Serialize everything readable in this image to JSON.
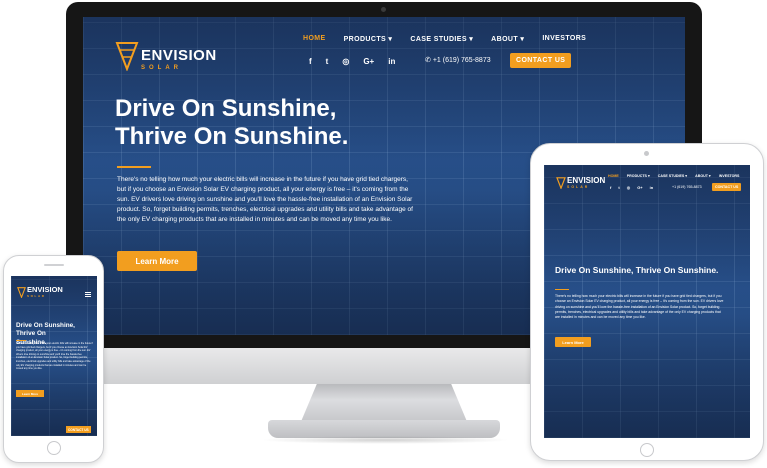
{
  "brand": {
    "name": "ENVISION",
    "tagline": "SOLAR",
    "accent_color": "#f29e1f",
    "screen_color": "#23457a"
  },
  "nav": {
    "items": [
      {
        "label": "HOME",
        "active": true
      },
      {
        "label": "PRODUCTS ▾",
        "active": false
      },
      {
        "label": "CASE STUDIES ▾",
        "active": false
      },
      {
        "label": "ABOUT ▾",
        "active": false
      },
      {
        "label": "INVESTORS",
        "active": false
      }
    ]
  },
  "social": {
    "icons": [
      {
        "name": "facebook-icon",
        "glyph": "f"
      },
      {
        "name": "twitter-icon",
        "glyph": "🐦"
      },
      {
        "name": "instagram-icon",
        "glyph": "◎"
      },
      {
        "name": "google-plus-icon",
        "glyph": "G+"
      },
      {
        "name": "linkedin-icon",
        "glyph": "in"
      }
    ],
    "phone": "+1 (619) 765-8873",
    "phone_icon": "phone-icon"
  },
  "contact_button": "CONTACT US",
  "hero": {
    "headline_line1": "Drive On Sunshine,",
    "headline_line2": "Thrive On Sunshine.",
    "body": "There's no telling how much your electric bills will increase in the future if you have grid tied chargers, but if you choose an Envision Solar EV charging product, all your energy is free – it's coming from the sun. EV drivers love driving on sunshine and you'll love the hassle-free installation of an Envision Solar product. So, forget building permits, trenches, electrical upgrades and utility bills and take advantage of the only EV charging products that are installed in minutes and can be moved any time you like.",
    "button": "Learn More"
  },
  "tablet": {
    "headline": "Drive On Sunshine, Thrive On Sunshine."
  },
  "mobile": {
    "headline_line1": "Drive On Sunshine, Thrive On",
    "headline_line2": "Sunshine."
  }
}
